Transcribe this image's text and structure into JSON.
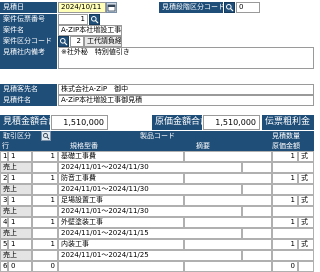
{
  "header": {
    "estimate_date_label": "見積日",
    "estimate_date_value": "2024/10/11",
    "stage_code_label": "見積段階区分コード",
    "stage_code_value": "0",
    "project_no_label": "案件伝票番号",
    "project_no_value": "1",
    "project_name_label": "案件名",
    "project_name_value": "A-ZIP本社増設工事",
    "category_code_label": "案件区分コード",
    "category_code_value": "2",
    "category_code_name": "工代請負経由",
    "remarks_label": "見積社内備考",
    "remarks_value": "※社外秘　特別値引き",
    "customer_label": "見積客先名",
    "customer_value": "株式会社A-ZiP　御中",
    "subject_label": "見積件名",
    "subject_value": "A-ZiP本社増設工事御見積"
  },
  "totals": {
    "estimate_total_label": "見積金額合計",
    "estimate_total_value": "1,510,000",
    "cost_total_label": "原価金額合計",
    "cost_total_value": "1,510,000",
    "slip_label": "伝票粗利金"
  },
  "grid": {
    "col_torihiki": "取引区分",
    "col_product_code": "製品コード",
    "col_qty_unit": "見積数量",
    "col_row_no": "行",
    "col_spec": "規格型番",
    "col_summary": "摘要",
    "col_cost_unit": "原価金額",
    "rows": [
      {
        "no": "1",
        "kubun": "1",
        "torihiki_label": "売上",
        "code": "1",
        "name": "基礎工事費",
        "summary": "2024/11/01～2024/11/30",
        "qty": "1",
        "unit": "式"
      },
      {
        "no": "2",
        "kubun": "1",
        "torihiki_label": "売上",
        "code": "1",
        "name": "防音工事費",
        "summary": "2024/11/01～2024/11/30",
        "qty": "1",
        "unit": "式"
      },
      {
        "no": "3",
        "kubun": "1",
        "torihiki_label": "売上",
        "code": "1",
        "name": "足場設置工事",
        "summary": "2024/11/01～2024/11/30",
        "qty": "1",
        "unit": "式"
      },
      {
        "no": "4",
        "kubun": "1",
        "torihiki_label": "売上",
        "code": "1",
        "name": "外壁塗装工事",
        "summary": "2024/11/01～2024/11/15",
        "qty": "1",
        "unit": "式"
      },
      {
        "no": "5",
        "kubun": "1",
        "torihiki_label": "売上",
        "code": "1",
        "name": "内装工事",
        "summary": "2024/11/01～2024/11/25",
        "qty": "1",
        "unit": "式"
      },
      {
        "no": "6",
        "kubun": "0",
        "code": "0",
        "qty": "0"
      }
    ]
  },
  "icons": [
    "search-icon",
    "calendar-icon",
    "sort-icon"
  ],
  "colors": {
    "label_bg": "#1f4e79",
    "input_yellow": "#ffffb8",
    "header_bg": "#1f4e79"
  }
}
